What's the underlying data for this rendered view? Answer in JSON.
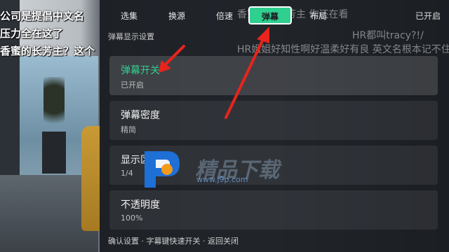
{
  "background": {
    "danmaku": [
      "公司是提倡中文名",
      "压力全在这了",
      "香蜜的长芳主？这个"
    ]
  },
  "panel": {
    "danmaku": [
      "香蜜里的长芳主 你还在看",
      "HR都叫tracy?!/",
      "HR姐姐好知性啊好温柔好有良  英文名根本记不住"
    ],
    "tabs": [
      {
        "label": "选集"
      },
      {
        "label": "换源"
      },
      {
        "label": "倍速"
      },
      {
        "label": "弹幕",
        "selected": true
      },
      {
        "label": "布局"
      }
    ],
    "status": "已开启",
    "section_title": "弹幕显示设置",
    "items": [
      {
        "title": "弹幕开关",
        "value": "已开启",
        "active": true
      },
      {
        "title": "弹幕密度",
        "value": "精简"
      },
      {
        "title": "显示区域",
        "value": "1/4"
      },
      {
        "title": "不透明度",
        "value": "100%"
      }
    ],
    "footer": "确认设置 · 字幕键快速开关 · 返回关闭"
  },
  "watermark": {
    "text": "精品下载",
    "url": "www.j9p.com"
  },
  "colors": {
    "accent": "#2fcf8f",
    "annotation": "#e8241c"
  }
}
